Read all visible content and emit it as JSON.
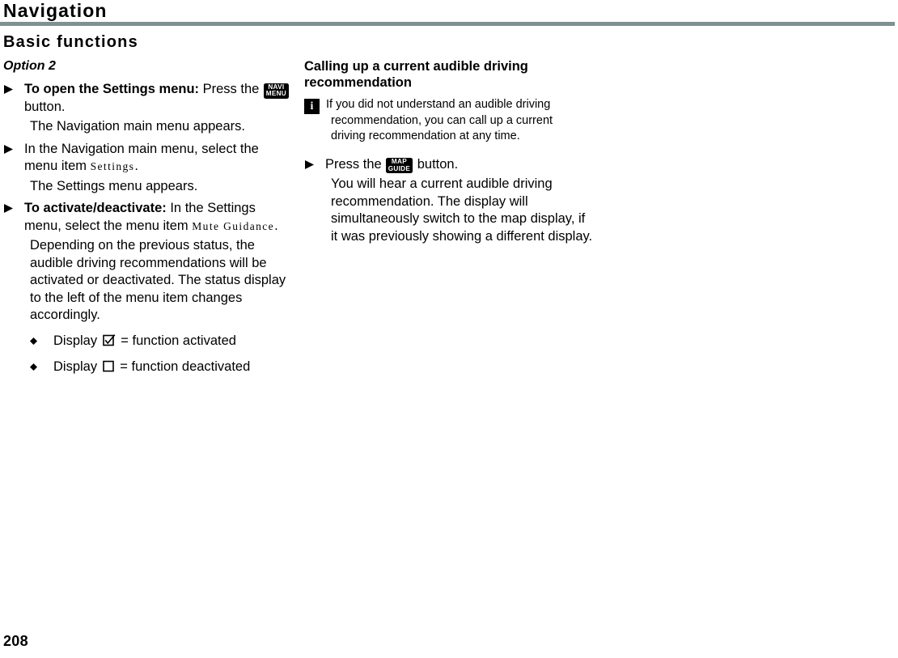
{
  "header": {
    "chapter_title": "Navigation",
    "section_title": "Basic functions",
    "rule_color": "#7e9193"
  },
  "left_column": {
    "subhead": "Option 2",
    "steps": [
      {
        "bullet_icon": "triangle-right-icon",
        "lead": "To open the Settings menu:",
        "text_before_button": " Press the ",
        "button": {
          "icon": "navi-menu-button-icon",
          "line1": "NAVI",
          "line2": "MENU"
        },
        "text_after_button": " button.",
        "result": "The Navigation main menu appears."
      },
      {
        "bullet_icon": "triangle-right-icon",
        "text_before_item": "In the Navigation main menu, select the menu item ",
        "menu_item": "Settings",
        "text_after_item": ".",
        "result": "The Settings menu appears."
      },
      {
        "bullet_icon": "triangle-right-icon",
        "lead": "To activate/deactivate:",
        "text_before_item": " In the Settings menu, select the menu item ",
        "menu_item": "Mute Guidance",
        "text_after_item": ".",
        "result": "Depending on the previous status, the audible driving recommendations will be activated or deactivated. The status display to the left of the menu item changes accordingly."
      }
    ],
    "status_list": [
      {
        "bullet_icon": "diamond-bullet-icon",
        "label": "Display",
        "state_icon": "checkbox-checked-icon",
        "description": "= function activated"
      },
      {
        "bullet_icon": "diamond-bullet-icon",
        "label": "Display",
        "state_icon": "checkbox-empty-icon",
        "description": "= function deactivated"
      }
    ]
  },
  "right_column": {
    "heading": "Calling up a current audible driving recommendation",
    "note": {
      "icon": "info-icon",
      "icon_label": "i",
      "line1": "If you did not understand an audible driving",
      "line2": "recommendation, you can call up a current",
      "line3": "driving recommendation at any time."
    },
    "step": {
      "bullet_icon": "triangle-right-icon",
      "text_before_button": "Press the ",
      "button": {
        "icon": "map-guide-button-icon",
        "line1": "MAP",
        "line2": "GUIDE"
      },
      "text_after_button": " button.",
      "result": "You will hear a current audible driving recommendation. The display will simultaneously switch to the map display, if it was previously showing a different display."
    }
  },
  "footer": {
    "page_number": "208"
  }
}
